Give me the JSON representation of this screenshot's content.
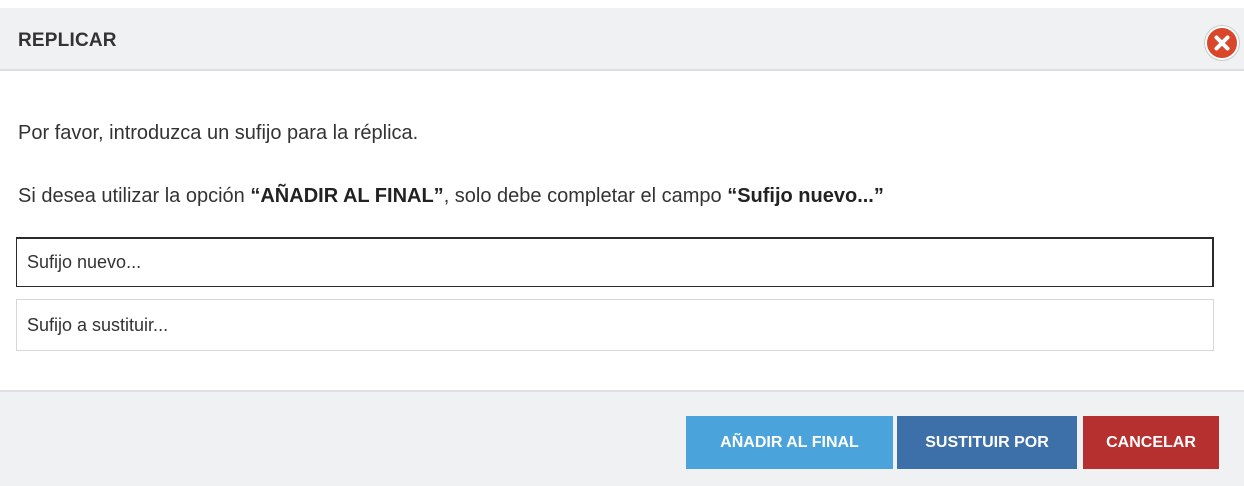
{
  "dialog": {
    "title": "REPLICAR",
    "close_icon": "close-icon"
  },
  "body": {
    "message_1": "Por favor, introduzca un sufijo para la réplica.",
    "message_2": {
      "prefix": "Si desea utilizar la opción ",
      "option": "“AÑADIR AL FINAL”",
      "middle": ", solo debe completar el campo ",
      "field": "“Sufijo nuevo...”"
    }
  },
  "fields": {
    "new_suffix": {
      "placeholder": "Sufijo nuevo...",
      "value": ""
    },
    "replace_suffix": {
      "placeholder": "Sufijo a sustituir...",
      "value": ""
    }
  },
  "buttons": {
    "append": "AÑADIR AL FINAL",
    "replace": "SUSTITUIR POR",
    "cancel": "CANCELAR"
  },
  "colors": {
    "append": "#4aa3da",
    "replace": "#3d6fa8",
    "cancel": "#b5302f",
    "close": "#d9472b",
    "header_bg": "#f0f1f3"
  }
}
